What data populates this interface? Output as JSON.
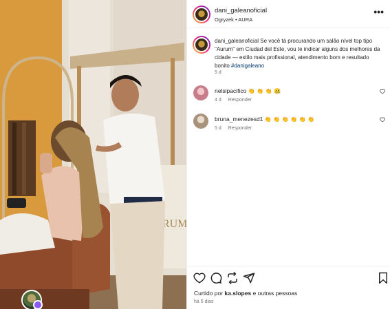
{
  "post": {
    "author": "dani_galeanoficial",
    "location_line": "Ogryzek • AURA",
    "more_label": "•••"
  },
  "caption": {
    "author": "dani_galeanoficial",
    "text": " Se você tá procurando um salão nível top tipo \"Aurum\" em Ciudad del Este, vou te indicar alguns dos melhores da cidade — estilo mais profissional, atendimento bom e resultado bonito ",
    "hashtag": "#danigaleano",
    "time": "5 d"
  },
  "comments": [
    {
      "author": "nelsipacifico",
      "emojis": "👏 👏 👏 🤐",
      "time": "4 d",
      "reply_label": "Responder",
      "avatar_color": "#c77d8a"
    },
    {
      "author": "bruna_menezesd1",
      "emojis": "👏 👏 👏 👏 👏 👏",
      "time": "5 d",
      "reply_label": "Responder",
      "avatar_color": "#a9927a"
    }
  ],
  "actions": {
    "icons": [
      "heart-icon",
      "comment-icon",
      "share-icon",
      "send-icon",
      "bookmark-icon"
    ],
    "liked_prefix": "Curtido por ",
    "liked_user": "ka.slopes",
    "liked_suffix": " e outras pessoas",
    "post_time": "há 5 dias"
  },
  "colors": {
    "link": "#00376b",
    "muted": "#737373",
    "text": "#262626",
    "divider": "#efefef",
    "story_ring": [
      "#f9ce34",
      "#ee2a7b",
      "#6228d7"
    ]
  }
}
